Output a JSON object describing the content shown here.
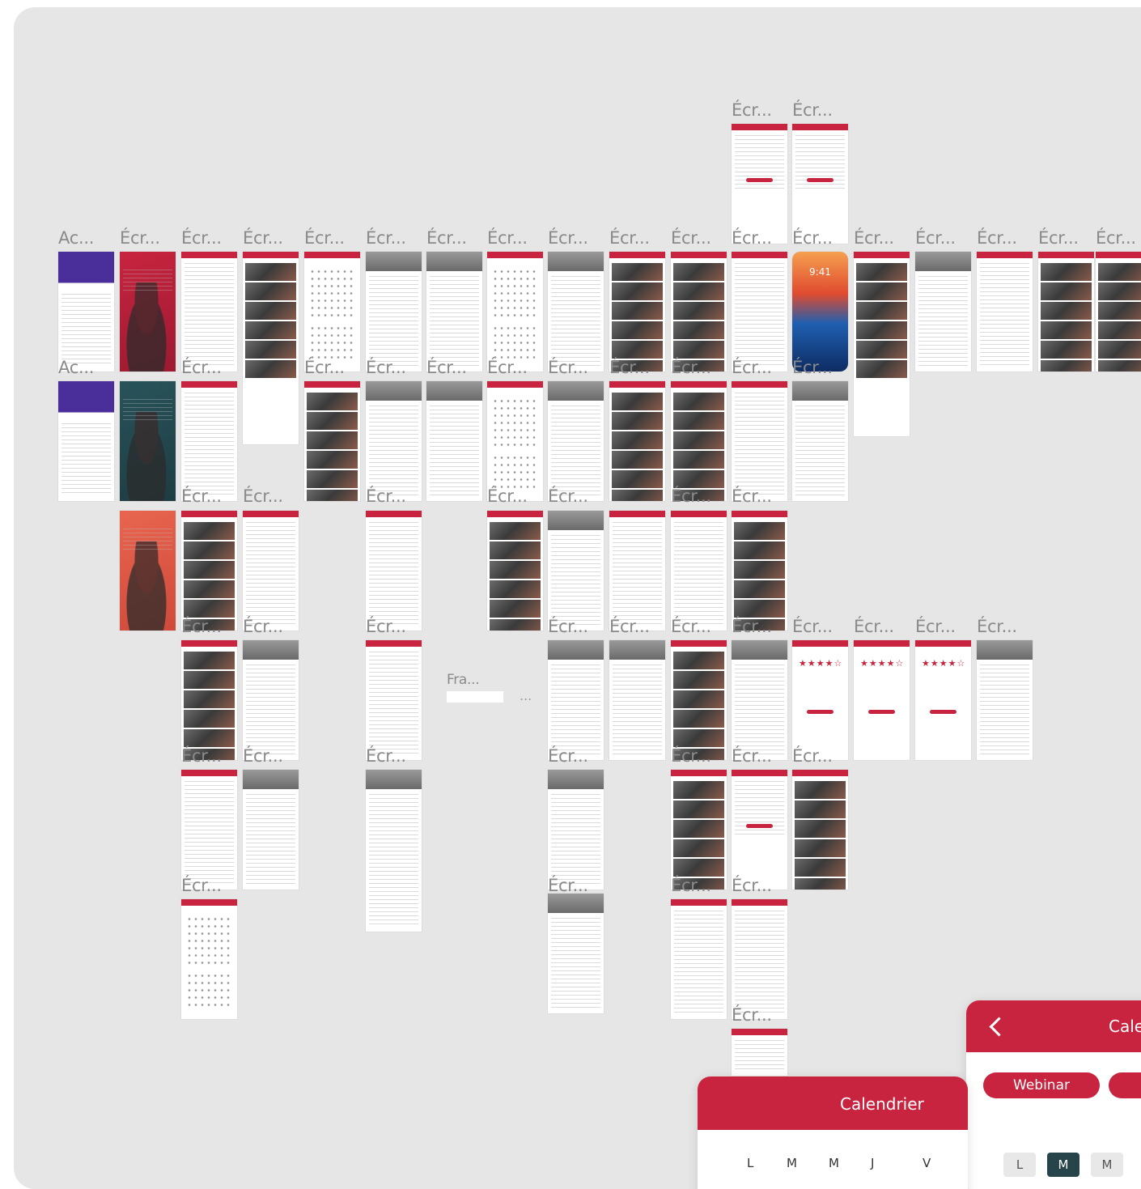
{
  "canvas": {
    "frame_label_short": "Écr...",
    "frame_label_ac": "Ac...",
    "frame_label_fra": "Fra...",
    "more_label": "...",
    "phone_time": "9:41"
  },
  "ratings": {
    "stars": "★★★★☆"
  },
  "calendar_card_front": {
    "title": "Calendrier",
    "weekdays": [
      "L",
      "M",
      "M",
      "J",
      "V"
    ]
  },
  "calendar_card_back": {
    "title": "Cale",
    "filters": [
      "Webinar"
    ],
    "day_cells": [
      "L",
      "M",
      "M"
    ]
  },
  "colors": {
    "brand_red": "#c8243f",
    "canvas_bg": "#e6e6e6",
    "selected_day": "#264449",
    "onboarding_purple": "#4a2f9a",
    "onboarding_teal": "#28535a",
    "onboarding_orange": "#e8654f"
  }
}
